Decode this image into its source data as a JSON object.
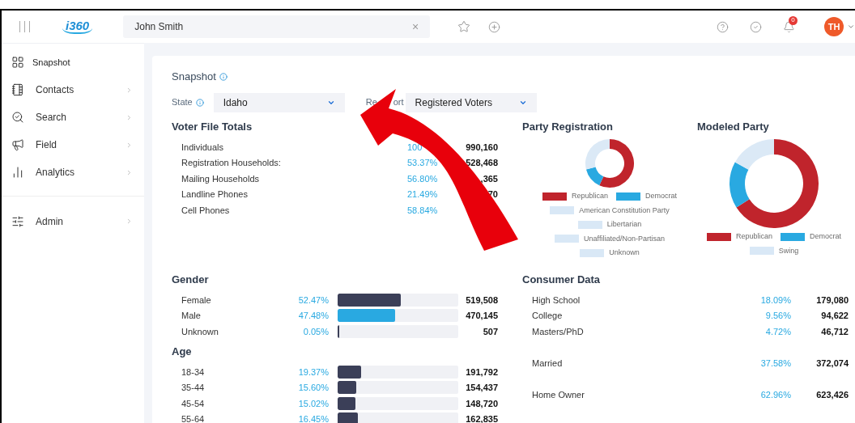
{
  "header": {
    "logo": "i360",
    "search": {
      "value": "John Smith",
      "clear": "×"
    },
    "avatar": "TH",
    "notification_badge": "0"
  },
  "sidebar": {
    "items": [
      {
        "label": "Snapshot",
        "selected": true,
        "has_submenu": false,
        "divider_before": false
      },
      {
        "label": "Contacts",
        "selected": false,
        "has_submenu": true,
        "divider_before": false
      },
      {
        "label": "Search",
        "selected": false,
        "has_submenu": true,
        "divider_before": false
      },
      {
        "label": "Field",
        "selected": false,
        "has_submenu": true,
        "divider_before": false
      },
      {
        "label": "Analytics",
        "selected": false,
        "has_submenu": true,
        "divider_before": false
      },
      {
        "label": "Admin",
        "selected": false,
        "has_submenu": true,
        "divider_before": true
      }
    ]
  },
  "page": {
    "title": "Snapshot",
    "state_label": "State",
    "state_value": "Idaho",
    "report_label_parts": [
      "Re",
      "ort"
    ],
    "report_value": "Registered Voters"
  },
  "voter_file_totals": {
    "title": "Voter File Totals",
    "rows": [
      {
        "label": "Individuals",
        "percent": "100",
        "count": "990,160"
      },
      {
        "label": "Registration Households:",
        "percent": "53.37%",
        "count": "528,468"
      },
      {
        "label": "Mailing Households",
        "percent": "56.80%",
        "count": ",365"
      },
      {
        "label": "Landline Phones",
        "percent": "21.49%",
        "count": "70"
      },
      {
        "label": "Cell Phones",
        "percent": "58.84%"
      }
    ]
  },
  "party_registration": {
    "title": "Party Registration",
    "legend": [
      {
        "label": "Republican",
        "color": "#c0242c"
      },
      {
        "label": "Democrat",
        "color": "#29a9e1"
      },
      {
        "label": "American Constitution Party",
        "color": "#d9e8f6"
      },
      {
        "label": "Libertarian",
        "color": "#d9e8f6"
      },
      {
        "label": "Unaffiliated/Non-Partisan",
        "color": "#d9e8f6"
      },
      {
        "label": "Unknown",
        "color": "#d9e8f6"
      }
    ]
  },
  "modeled_party": {
    "title": "Modeled Party",
    "legend": [
      {
        "label": "Republican",
        "color": "#c0242c"
      },
      {
        "label": "Democrat",
        "color": "#29a9e1"
      },
      {
        "label": "Swing",
        "color": "#d9e8f6"
      }
    ]
  },
  "gender": {
    "title": "Gender",
    "rows": [
      {
        "label": "Female",
        "percent": "52.47%",
        "level": 0.5247,
        "color": "#3b3f58",
        "count": "519,508"
      },
      {
        "label": "Male",
        "percent": "47.48%",
        "level": 0.4748,
        "color": "#29a9e1",
        "count": "470,145"
      },
      {
        "label": "Unknown",
        "percent": "0.05%",
        "level": 0.005,
        "color": "#3b3f58",
        "count": "507"
      }
    ]
  },
  "age": {
    "title": "Age",
    "rows": [
      {
        "label": "18-34",
        "percent": "19.37%",
        "level": 0.1937,
        "color": "#3b3f58",
        "count": "191,792"
      },
      {
        "label": "35-44",
        "percent": "15.60%",
        "level": 0.156,
        "color": "#3b3f58",
        "count": "154,437"
      },
      {
        "label": "45-54",
        "percent": "15.02%",
        "level": 0.1502,
        "color": "#3b3f58",
        "count": "148,720"
      },
      {
        "label": "55-64",
        "percent": "16.45%",
        "level": 0.1645,
        "color": "#3b3f58",
        "count": "162,835"
      }
    ]
  },
  "consumer_data": {
    "title": "Consumer Data",
    "rows": [
      {
        "label": "High School",
        "percent": "18.09%",
        "count": "179,080",
        "gap_before": false
      },
      {
        "label": "College",
        "percent": "9.56%",
        "count": "94,622",
        "gap_before": false
      },
      {
        "label": "Masters/PhD",
        "percent": "4.72%",
        "count": "46,712",
        "gap_before": false
      },
      {
        "label": "Married",
        "percent": "37.58%",
        "count": "372,074",
        "gap_before": true
      },
      {
        "label": "Home Owner",
        "percent": "62.96%",
        "count": "623,426",
        "gap_before": true
      }
    ]
  }
}
